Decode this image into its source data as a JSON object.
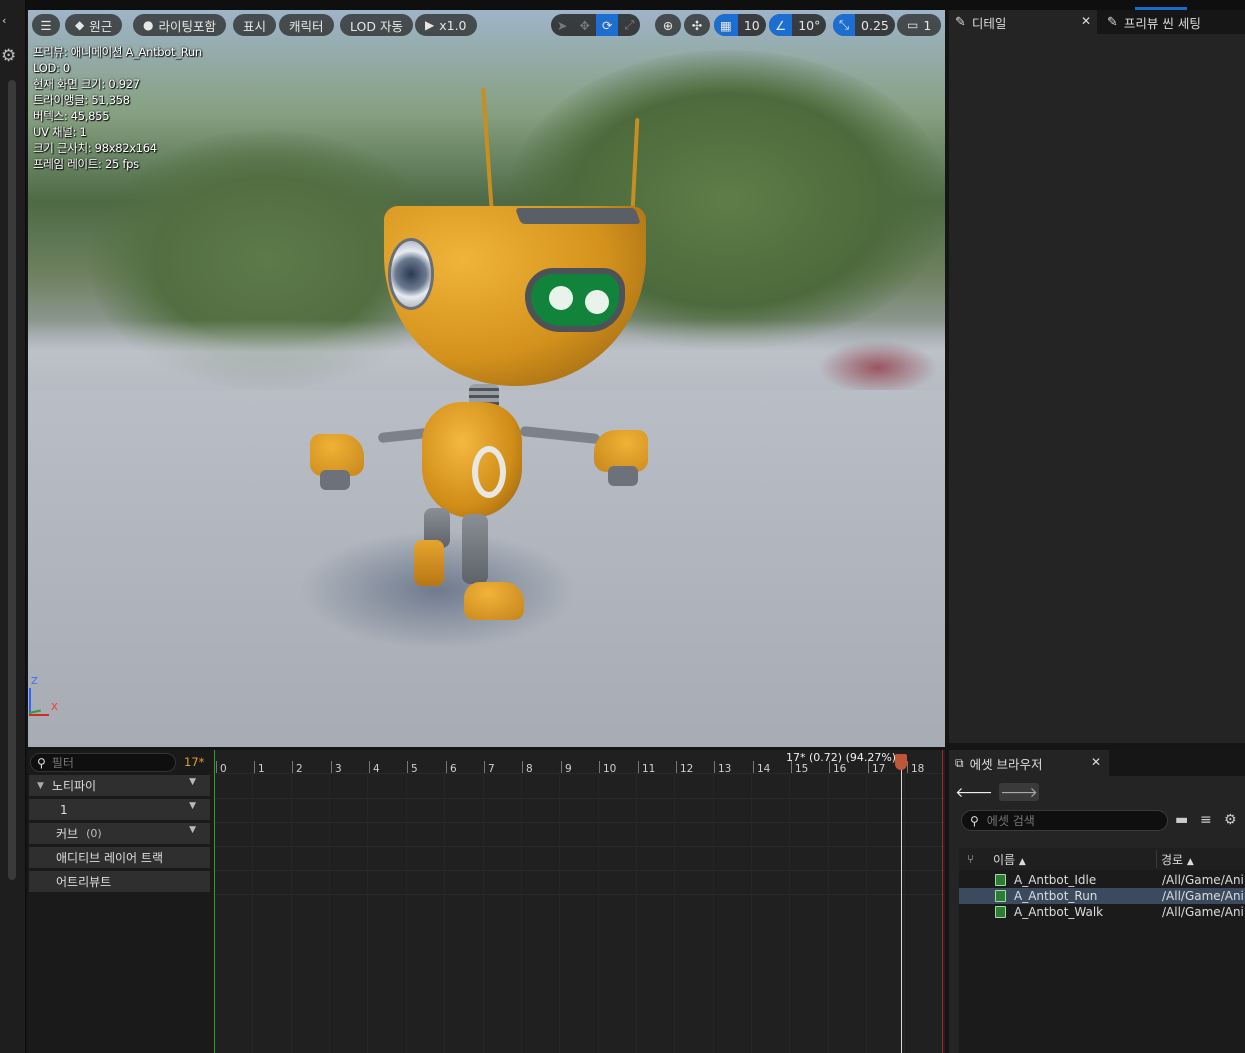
{
  "viewport": {
    "toolbar": {
      "menu_icon": "hamburger-icon",
      "perspective_label": "원근",
      "lighting_label": "라이팅포함",
      "show_label": "표시",
      "character_label": "캐릭터",
      "lod_label": "LOD 자동",
      "play_speed_label": "x1.0",
      "grid_snap_value": "10",
      "rotation_snap_value": "10°",
      "scale_snap_value": "0.25",
      "camera_speed_value": "1"
    },
    "stats": [
      "프리뷰: 애니메이션 A_Antbot_Run",
      "LOD: 0",
      "현재 화면 크기: 0.927",
      "트라이앵글: 51,358",
      "버텍스: 45,855",
      "UV 채널: 1",
      "크기 근사치: 98x82x164",
      "프레임 레이트: 25 fps"
    ],
    "axis": {
      "z": "Z",
      "x": "X"
    }
  },
  "details_panel": {
    "tabs": [
      {
        "label": "디테일",
        "icon": "pencil-icon"
      },
      {
        "label": "프리뷰 씬 세팅",
        "icon": "pencil-icon"
      }
    ]
  },
  "timeline": {
    "filter_placeholder": "필터",
    "current_frame": "17*",
    "tracks": [
      {
        "label": "노티파이",
        "has_expand": true
      },
      {
        "label": "1"
      },
      {
        "label": "커브",
        "count": "(0)"
      },
      {
        "label": "애디티브 레이어 트랙"
      },
      {
        "label": "어트리뷰트"
      }
    ],
    "ticks": [
      "0",
      "1",
      "2",
      "3",
      "4",
      "5",
      "6",
      "7",
      "8",
      "9",
      "10",
      "11",
      "12",
      "13",
      "14",
      "15",
      "16",
      "17",
      "18"
    ],
    "scrubber_label": "17* (0.72) (94.27%)"
  },
  "asset_browser": {
    "tab_label": "에셋 브라우저",
    "search_placeholder": "에셋 검색",
    "columns": {
      "name": "이름",
      "path": "경로"
    },
    "rows": [
      {
        "name": "A_Antbot_Idle",
        "path": "/All/Game/Ani",
        "selected": false
      },
      {
        "name": "A_Antbot_Run",
        "path": "/All/Game/Ani",
        "selected": true
      },
      {
        "name": "A_Antbot_Walk",
        "path": "/All/Game/Ani",
        "selected": false
      }
    ]
  }
}
